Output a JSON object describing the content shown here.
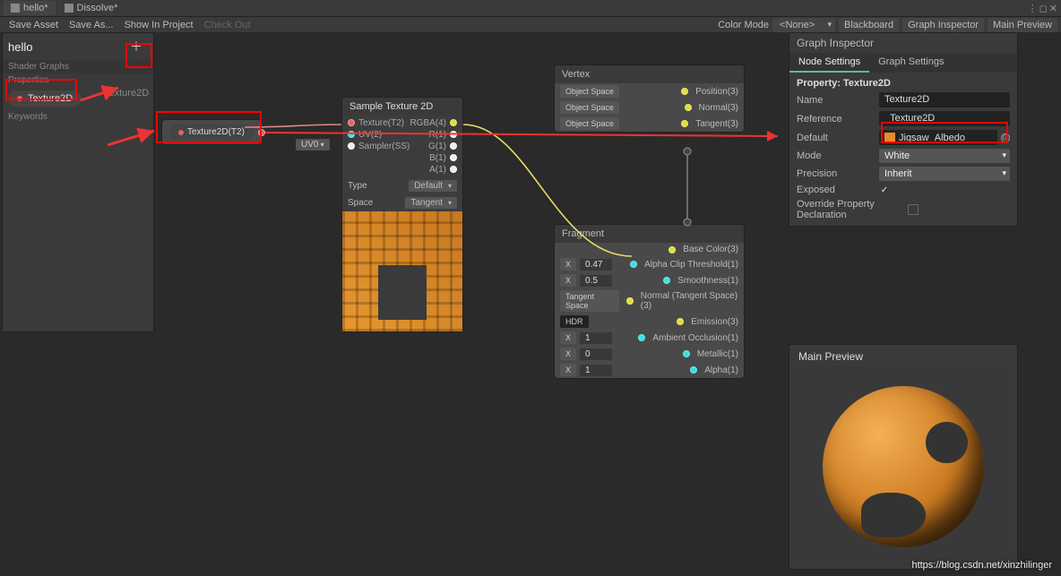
{
  "window_tabs": {
    "tab1": "hello*",
    "tab2": "Dissolve*"
  },
  "toolbar": {
    "save_asset": "Save Asset",
    "save_as": "Save As...",
    "show_in_project": "Show In Project",
    "check_out": "Check Out",
    "color_mode": "Color Mode",
    "color_mode_value": "<None>",
    "blackboard": "Blackboard",
    "graph_inspector": "Graph Inspector",
    "main_preview": "Main Preview"
  },
  "blackboard": {
    "title": "hello",
    "subtitle": "Shader Graphs",
    "section": "Properties",
    "keywords": "Keywords",
    "prop_label": "Texture2D"
  },
  "graph_token": "Texture2D(T2)",
  "hint_token": "Texture2D",
  "uv_chip": "UV0",
  "sample_node": {
    "title": "Sample Texture 2D",
    "in1": "Texture(T2)",
    "in2": "UV(2)",
    "in3": "Sampler(SS)",
    "out1": "RGBA(4)",
    "out2": "R(1)",
    "out3": "G(1)",
    "out4": "B(1)",
    "out5": "A(1)",
    "type_label": "Type",
    "type_value": "Default",
    "space_label": "Space",
    "space_value": "Tangent"
  },
  "vertex": {
    "title": "Vertex",
    "chip": "Object Space",
    "p1": "Position(3)",
    "p2": "Normal(3)",
    "p3": "Tangent(3)"
  },
  "fragment": {
    "title": "Fragment",
    "p1": "Base Color(3)",
    "p2": "Alpha Clip Threshold(1)",
    "p3": "Smoothness(1)",
    "p4": "Normal (Tangent Space)(3)",
    "p5": "Emission(3)",
    "p6": "Ambient Occlusion(1)",
    "p7": "Metallic(1)",
    "p8": "Alpha(1)",
    "x": "X",
    "v_047": "0.47",
    "v_05": "0.5",
    "v_1a": "1",
    "v_0": "0",
    "v_1b": "1",
    "chip_ts": "Tangent Space",
    "chip_hdr": "HDR"
  },
  "inspector": {
    "title": "Graph Inspector",
    "tab1": "Node Settings",
    "tab2": "Graph Settings",
    "prop_title": "Property: Texture2D",
    "name": "Name",
    "name_v": "Texture2D",
    "ref": "Reference",
    "ref_v": "_Texture2D",
    "default": "Default",
    "default_v": "Jigsaw_Albedo",
    "mode": "Mode",
    "mode_v": "White",
    "precision": "Precision",
    "precision_v": "Inherit",
    "exposed": "Exposed",
    "override": "Override Property Declaration"
  },
  "mainpreview_title": "Main Preview",
  "watermark": "https://blog.csdn.net/xinzhilinger"
}
